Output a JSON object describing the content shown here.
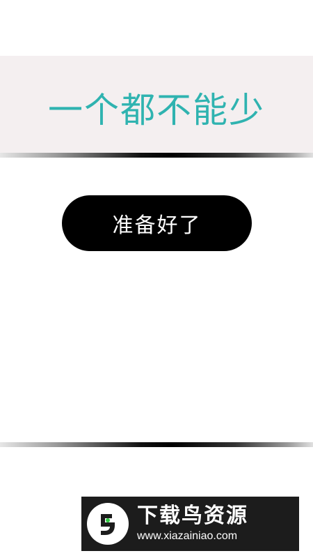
{
  "title": "一个都不能少",
  "button": {
    "ready_label": "准备好了"
  },
  "watermark": {
    "name": "下载鸟资源",
    "url": "www.xiazainiao.com",
    "logo_icon": "bird-logo-icon",
    "logo_color": "#1c1c1c",
    "logo_dot_color": "#2ecc40"
  },
  "colors": {
    "title": "#2fb3b0",
    "title_band": "#f4eff0",
    "button_bg": "#000000",
    "button_text": "#ffffff"
  }
}
